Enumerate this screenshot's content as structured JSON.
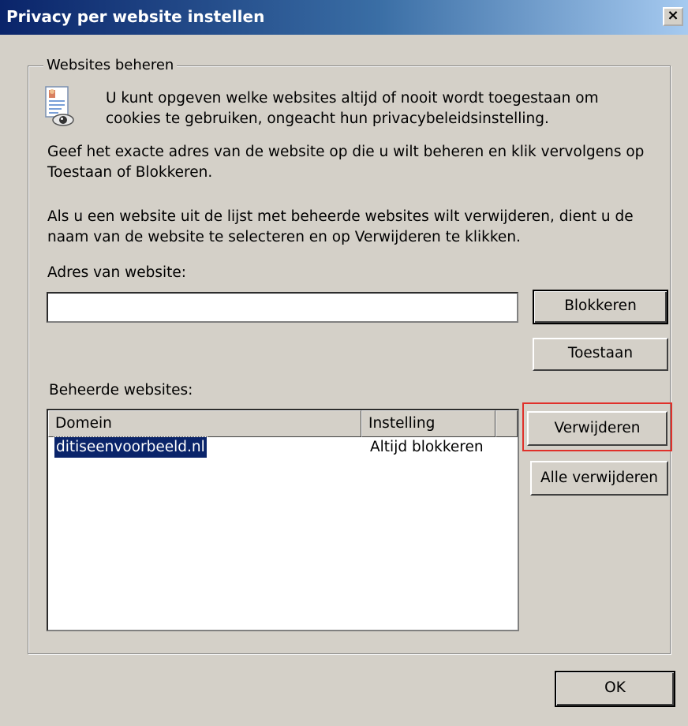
{
  "window": {
    "title": "Privacy per website instellen",
    "close_label": "×"
  },
  "group": {
    "label": "Websites beheren",
    "intro": [
      "U kunt opgeven welke websites altijd of nooit wordt toegestaan om",
      "cookies te gebruiken, ongeacht hun privacybeleidsinstelling."
    ],
    "instructions_1": [
      "Geef het exacte adres van de website op die u wilt beheren en klik vervolgens op",
      "Toestaan of Blokkeren."
    ],
    "instructions_2": [
      "Als u een website uit de lijst met beheerde websites wilt verwijderen, dient u de",
      "naam van de website te selecteren en op Verwijderen te klikken."
    ],
    "address_label": "Adres van website:",
    "address_value": "",
    "managed_label": "Beheerde websites:"
  },
  "buttons": {
    "block": "Blokkeren",
    "allow": "Toestaan",
    "remove": "Verwijderen",
    "remove_all": "Alle verwijderen",
    "ok": "OK"
  },
  "list": {
    "columns": [
      "Domein",
      "Instelling"
    ],
    "rows": [
      {
        "domain": "ditiseenvoorbeeld.nl",
        "setting": "Altijd blokkeren",
        "selected": true
      }
    ]
  },
  "icons": {
    "doc": "privacy-document-eye-icon",
    "close": "close-icon"
  },
  "colors": {
    "titlebar_start": "#0a246a",
    "selection": "#0a246a",
    "highlight_box": "#e0302a"
  }
}
